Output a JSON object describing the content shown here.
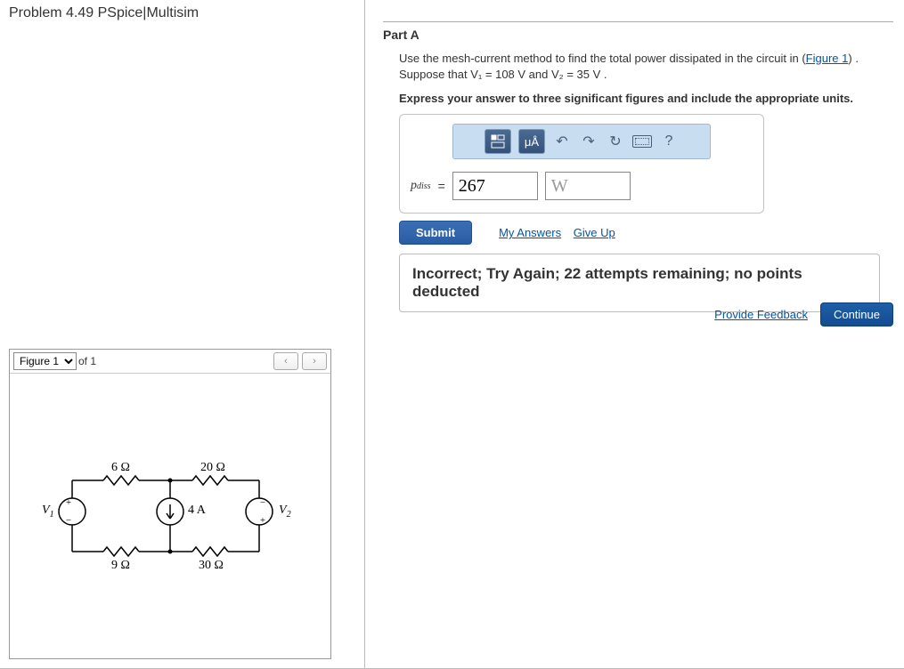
{
  "problem": {
    "title": "Problem 4.49 PSpice|Multisim"
  },
  "figure": {
    "select_label": "Figure 1",
    "of_text": "of 1",
    "labels": {
      "r6": "6 Ω",
      "r20": "20 Ω",
      "r9": "9 Ω",
      "r30": "30 Ω",
      "i4": "4 A",
      "v1": "V",
      "v1sub": "1",
      "v2": "V",
      "v2sub": "2"
    }
  },
  "part": {
    "label": "Part A",
    "prompt_1": "Use the mesh-current method to find the total power dissipated in the circuit in (",
    "figure_link": "Figure 1",
    "prompt_2": ") .",
    "prompt_3": "Suppose that V₁ = 108  V and V₂ = 35  V .",
    "instruction": "Express your answer to three significant figures and include the appropriate units.",
    "toolbar": {
      "templates_tip": "Templates",
      "units_label": "μÅ"
    },
    "answer": {
      "var_label": "pₐᵢₛₛ",
      "var_html_main": "p",
      "var_html_sub": "diss",
      "equals": "=",
      "value": "267",
      "unit": "W"
    },
    "submit_label": "Submit",
    "my_answers": "My Answers",
    "give_up": "Give Up",
    "feedback": "Incorrect; Try Again; 22 attempts remaining; no points deducted"
  },
  "footer": {
    "provide_feedback": "Provide Feedback",
    "continue": "Continue"
  }
}
